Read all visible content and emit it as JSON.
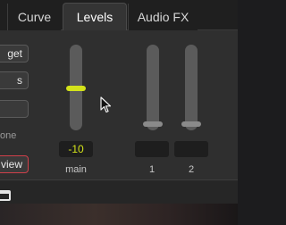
{
  "tabs": [
    {
      "label": "Curve"
    },
    {
      "label": "Levels"
    },
    {
      "label": "Audio FX"
    }
  ],
  "active_tab": "Levels",
  "left_buttons": [
    {
      "label": "get"
    },
    {
      "label": "s"
    },
    {
      "label": ""
    },
    {
      "label": "view"
    }
  ],
  "left_text": "one",
  "channels": [
    {
      "label": "main",
      "value": "-10",
      "active": true
    },
    {
      "label": "1",
      "value": "",
      "active": false
    },
    {
      "label": "2",
      "value": "",
      "active": false
    }
  ],
  "colors": {
    "accent": "#d4e31a",
    "review_border": "#d0404a",
    "track": "#5b5b5b"
  }
}
